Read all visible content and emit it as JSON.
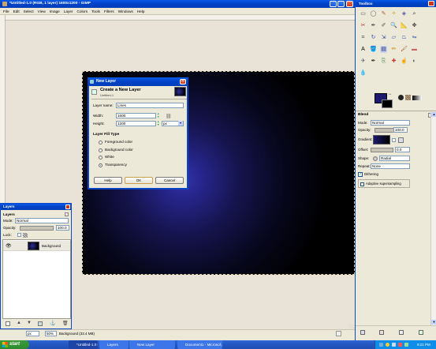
{
  "window": {
    "title": "*Untitled-1.0 (RGB, 1 layer) 1600x1200 - GIMP"
  },
  "menu": [
    "File",
    "Edit",
    "Select",
    "View",
    "Image",
    "Layer",
    "Colors",
    "Tools",
    "Filters",
    "Windows",
    "Help"
  ],
  "status": {
    "unit": "px",
    "zoom": "50%",
    "layer_info": "Background (33.4 MB)"
  },
  "dialog": {
    "title": "New Layer",
    "heading": "Create a New Layer",
    "subheading": "Untitled-1",
    "layer_name_label": "Layer name:",
    "layer_name_value": "Lines",
    "width_label": "Width:",
    "width_value": "1600",
    "height_label": "Height:",
    "height_value": "1200",
    "unit": "px",
    "fill_type_label": "Layer Fill Type",
    "fill_options": [
      "Foreground color",
      "Background color",
      "White",
      "Transparency"
    ],
    "fill_selected": "Transparency",
    "help_label": "Help",
    "ok_label": "OK",
    "cancel_label": "Cancel"
  },
  "layers_panel": {
    "window_title": "Layers",
    "tab_label": "Layers",
    "mode_label": "Mode:",
    "mode_value": "Normal",
    "opacity_label": "Opacity:",
    "opacity_value": "100.0",
    "lock_label": "Lock:",
    "layer_name": "Background"
  },
  "toolbox": {
    "title": "Toolbox",
    "options_title": "Blend",
    "mode_label": "Mode:",
    "mode_value": "Normal",
    "opacity_label": "Opacity:",
    "opacity_value": "100.0",
    "gradient_label": "Gradient:",
    "offset_label": "Offset:",
    "offset_value": "0.0",
    "shape_label": "Shape:",
    "shape_value": "Radial",
    "repeat_label": "Repeat:",
    "repeat_value": "None",
    "dithering_label": "Dithering",
    "adaptive_label": "Adaptive supersampling",
    "fg_color": "#1b1a6e",
    "bg_color": "#000000"
  },
  "taskbar": {
    "start_label": "start",
    "items": [
      "*Untitled-1.0 (R...",
      "Layers",
      "New Layer",
      "Document1 - Microsof..."
    ],
    "time": "9:21 PM"
  }
}
